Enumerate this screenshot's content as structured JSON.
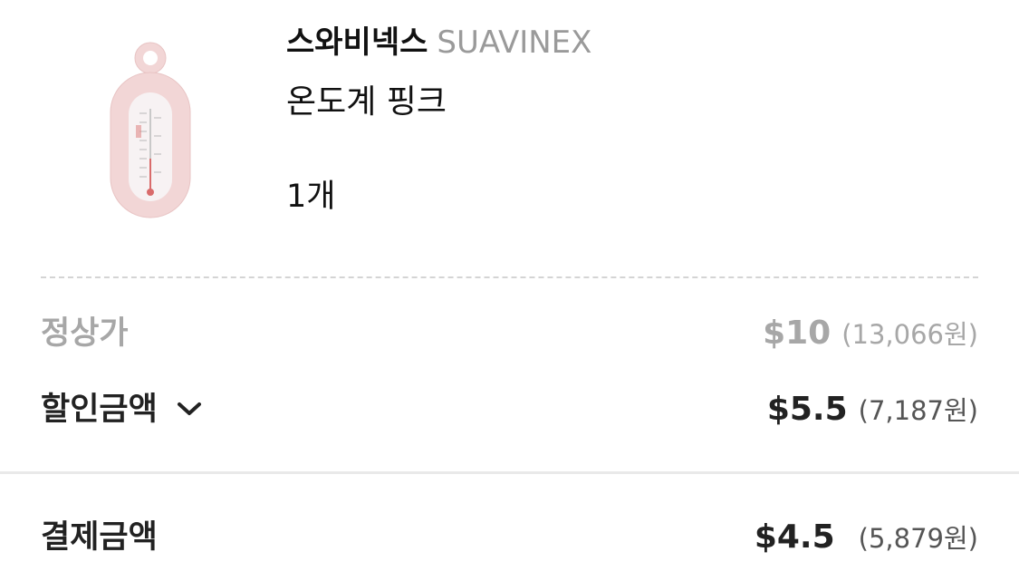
{
  "product": {
    "brand_kr": "스와비넥스",
    "brand_en": "SUAVINEX",
    "name": "온도계 핑크",
    "quantity": "1개",
    "image_icon": "thermometer-icon",
    "image_color": "#f2d6d6"
  },
  "prices": {
    "regular": {
      "label": "정상가",
      "usd": "$10",
      "krw": "(13,066원)"
    },
    "discount": {
      "label": "할인금액",
      "usd": "$5.5",
      "krw": "(7,187원)",
      "toggle_icon": "chevron-down-icon"
    },
    "total": {
      "label": "결제금액",
      "usd": "$4.5",
      "krw": "(5,879원)"
    }
  },
  "colors": {
    "muted_text": "#a7a7a7",
    "primary_text": "#222222"
  }
}
